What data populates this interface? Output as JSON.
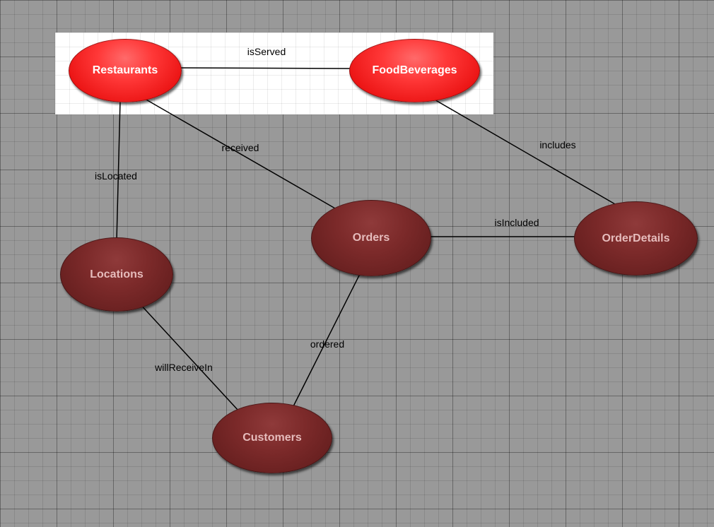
{
  "diagram": {
    "nodes": {
      "restaurants": {
        "label": "Restaurants"
      },
      "foodBeverages": {
        "label": "FoodBeverages"
      },
      "locations": {
        "label": "Locations"
      },
      "orders": {
        "label": "Orders"
      },
      "orderDetails": {
        "label": "OrderDetails"
      },
      "customers": {
        "label": "Customers"
      }
    },
    "edges": {
      "isServed": {
        "label": "isServed"
      },
      "received": {
        "label": "received"
      },
      "includes": {
        "label": "includes"
      },
      "isLocated": {
        "label": "isLocated"
      },
      "isIncluded": {
        "label": "isIncluded"
      },
      "willReceiveIn": {
        "label": "willReceiveIn"
      },
      "ordered": {
        "label": "ordered"
      }
    }
  },
  "colors": {
    "brightNode": "#ff2a2a",
    "darkNode": "#7a2a2a",
    "canvasBg": "#999999",
    "edge": "#000000"
  }
}
